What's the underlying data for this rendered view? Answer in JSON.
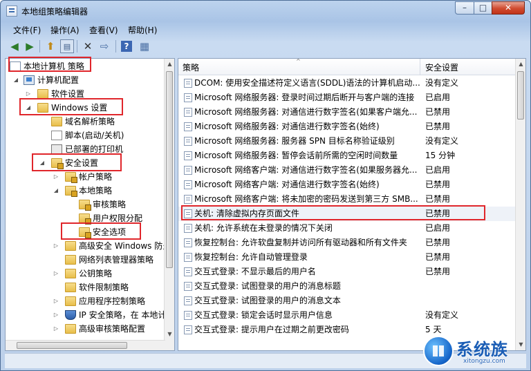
{
  "window": {
    "title": "本地组策略编辑器",
    "min": "–",
    "max": "□",
    "close": "✕"
  },
  "menu": [
    "文件(F)",
    "操作(A)",
    "查看(V)",
    "帮助(H)"
  ],
  "toolbar": {
    "icons": [
      "back-icon",
      "forward-icon",
      "up-folder-icon",
      "show-tree-icon",
      "delete-icon",
      "export-icon",
      "help-icon",
      "properties-icon"
    ]
  },
  "tree": {
    "root": "本地计算机 策略",
    "items": [
      {
        "label": "计算机配置"
      },
      {
        "label": "软件设置"
      },
      {
        "label": "Windows 设置"
      },
      {
        "label": "域名解析策略"
      },
      {
        "label": "脚本(启动/关机)"
      },
      {
        "label": "已部署的打印机"
      },
      {
        "label": "安全设置"
      },
      {
        "label": "帐户策略"
      },
      {
        "label": "本地策略"
      },
      {
        "label": "审核策略"
      },
      {
        "label": "用户权限分配"
      },
      {
        "label": "安全选项"
      },
      {
        "label": "高级安全 Windows 防火"
      },
      {
        "label": "网络列表管理器策略"
      },
      {
        "label": "公钥策略"
      },
      {
        "label": "软件限制策略"
      },
      {
        "label": "应用程序控制策略"
      },
      {
        "label": "IP 安全策略，在 本地计"
      },
      {
        "label": "高级审核策略配置"
      }
    ]
  },
  "columns": {
    "policy": "策略",
    "setting": "安全设置"
  },
  "rows": [
    {
      "name": "DCOM: 使用安全描述符定义语言(SDDL)语法的计算机启动...",
      "value": "没有定义"
    },
    {
      "name": "Microsoft 网络服务器: 登录时间过期后断开与客户端的连接",
      "value": "已启用"
    },
    {
      "name": "Microsoft 网络服务器: 对通信进行数字签名(如果客户端允...",
      "value": "已禁用"
    },
    {
      "name": "Microsoft 网络服务器: 对通信进行数字签名(始终)",
      "value": "已禁用"
    },
    {
      "name": "Microsoft 网络服务器: 服务器 SPN 目标名称验证级别",
      "value": "没有定义"
    },
    {
      "name": "Microsoft 网络服务器: 暂停会话前所需的空闲时间数量",
      "value": "15 分钟"
    },
    {
      "name": "Microsoft 网络客户端: 对通信进行数字签名(如果服务器允...",
      "value": "已启用"
    },
    {
      "name": "Microsoft 网络客户端: 对通信进行数字签名(始终)",
      "value": "已禁用"
    },
    {
      "name": "Microsoft 网络客户端: 将未加密的密码发送到第三方 SMB...",
      "value": "已禁用"
    },
    {
      "name": "关机: 清除虚拟内存页面文件",
      "value": "已禁用"
    },
    {
      "name": "关机: 允许系统在未登录的情况下关闭",
      "value": "已启用"
    },
    {
      "name": "恢复控制台: 允许软盘复制并访问所有驱动器和所有文件夹",
      "value": "已禁用"
    },
    {
      "name": "恢复控制台: 允许自动管理登录",
      "value": "已禁用"
    },
    {
      "name": "交互式登录: 不显示最后的用户名",
      "value": "已禁用"
    },
    {
      "name": "交互式登录: 试图登录的用户的消息标题",
      "value": ""
    },
    {
      "name": "交互式登录: 试图登录的用户的消息文本",
      "value": ""
    },
    {
      "name": "交互式登录: 锁定会话时显示用户信息",
      "value": "没有定义"
    },
    {
      "name": "交互式登录: 提示用户在过期之前更改密码",
      "value": "5 天"
    }
  ],
  "watermark": {
    "title": "系统族",
    "url": "xitongzu.com"
  },
  "colors": {
    "highlight": "#e0262b",
    "window_frame": "#a9c4e6"
  }
}
